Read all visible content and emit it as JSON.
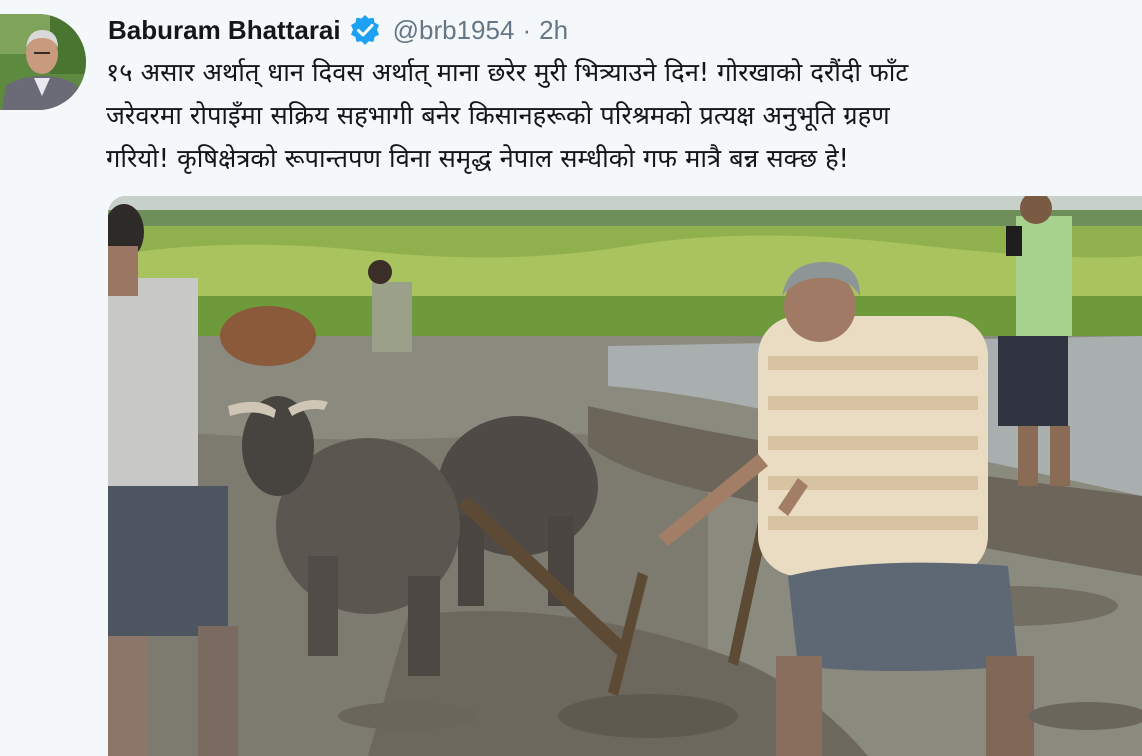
{
  "author": {
    "display_name": "Baburam Bhattarai",
    "handle": "@brb1954",
    "separator": "·",
    "time": "2h",
    "verified": true,
    "avatar_icon": "profile-photo"
  },
  "tweet": {
    "lines": [
      "१५ असार अर्थात् धान दिवस अर्थात् माना छरेर मुरी भित्र्याउने दिन! गोरखाको दरौंदी फाँट",
      "जरेवरमा रोपाइँमा सक्रिय सहभागी बनेर किसानहरूको परिश्रमको प्रत्यक्ष अनुभूति ग्रहण",
      "गरियो! कृषिक्षेत्रको रूपान्तपण विना समृद्ध नेपाल सम्धीको गफ मात्रै बन्न सक्छ हे!"
    ]
  },
  "media": {
    "type": "photo",
    "subject": "ploughing-rice-field-with-oxen"
  },
  "colors": {
    "verified_blue": "#1da1f2",
    "name_text": "#14171a",
    "meta_text": "#657786"
  }
}
